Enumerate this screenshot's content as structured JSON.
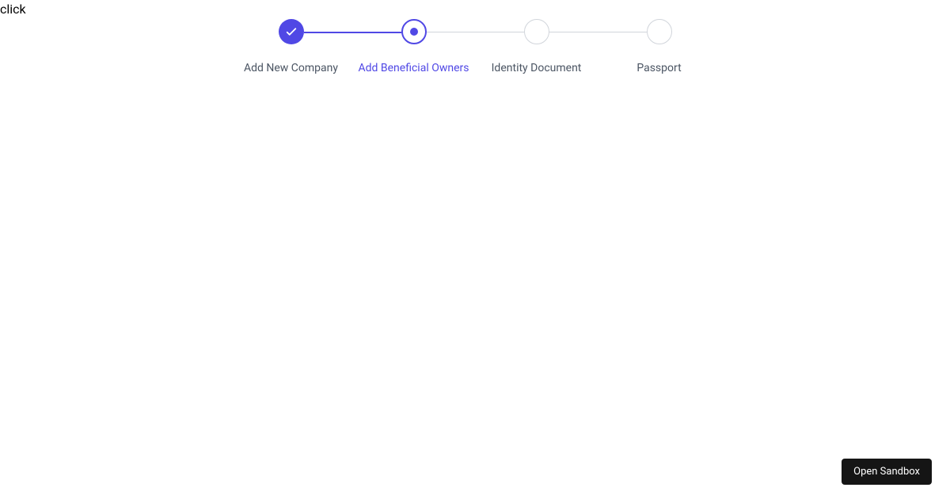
{
  "topLabel": "click",
  "stepper": {
    "steps": [
      {
        "label": "Add New Company",
        "state": "completed"
      },
      {
        "label": "Add Beneficial Owners",
        "state": "active"
      },
      {
        "label": "Identity Document",
        "state": "pending"
      },
      {
        "label": "Passport",
        "state": "pending"
      }
    ]
  },
  "sandboxButton": {
    "label": "Open Sandbox"
  }
}
